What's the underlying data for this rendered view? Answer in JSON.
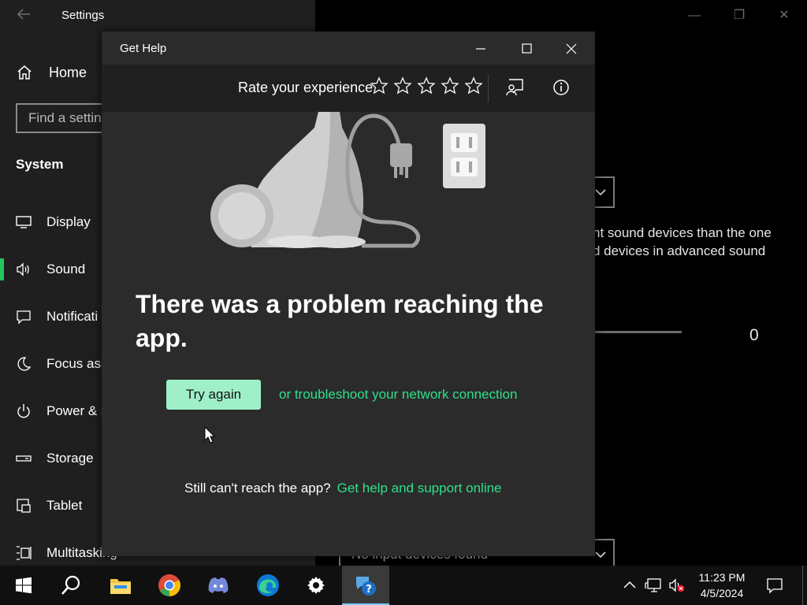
{
  "settings": {
    "title": "Settings",
    "home_label": "Home",
    "search_placeholder": "Find a settin",
    "section_title": "System",
    "nav_items": [
      {
        "label": "Display",
        "icon": "display-icon"
      },
      {
        "label": "Sound",
        "icon": "sound-icon",
        "selected": true
      },
      {
        "label": "Notificati",
        "icon": "notifications-icon"
      },
      {
        "label": "Focus ass",
        "icon": "focus-assist-icon"
      },
      {
        "label": "Power & s",
        "icon": "power-icon"
      },
      {
        "label": "Storage",
        "icon": "storage-icon"
      },
      {
        "label": "Tablet",
        "icon": "tablet-icon"
      },
      {
        "label": "Multitasking",
        "icon": "multitasking-icon"
      }
    ],
    "content": {
      "desc_line1": "nt sound devices than the one",
      "desc_line2": "d devices in advanced sound",
      "volume_value": "0",
      "input_dropdown": "No input devices found"
    }
  },
  "gethelp": {
    "title": "Get Help",
    "rate_label": "Rate your experience",
    "star_count": 5,
    "error_title": "There was a problem reaching the app.",
    "try_again": "Try again",
    "troubleshoot_link": "or troubleshoot your network connection",
    "still_text": "Still can't reach the app?",
    "support_link": "Get help and support online"
  },
  "taskbar": {
    "apps": [
      "start-icon",
      "search-icon",
      "file-explorer-icon",
      "chrome-icon",
      "discord-icon",
      "edge-icon",
      "settings-icon",
      "get-help-icon"
    ],
    "active_app": "get-help-icon",
    "time": "11:23 PM",
    "date": "4/5/2024"
  },
  "colors": {
    "accent_green": "#2ee08a",
    "button_green": "#9ff0c9",
    "selected_bar": "#22c55e"
  }
}
